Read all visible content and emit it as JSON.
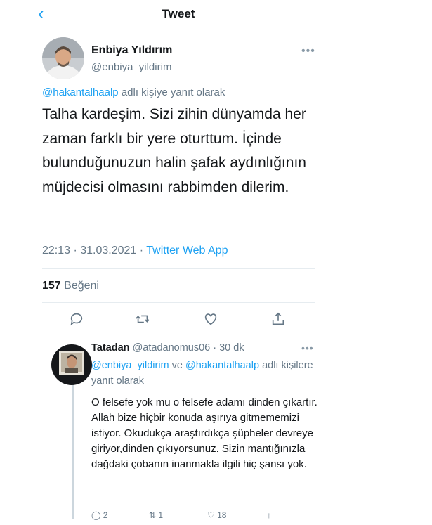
{
  "header": {
    "title": "Tweet"
  },
  "tweet": {
    "author_name": "Enbiya Yıldırım",
    "author_handle": "@enbiya_yildirim",
    "reply_to_handle": "@hakantalhaalp",
    "reply_to_suffix": "adlı kişiye yanıt olarak",
    "text": "Talha kardeşim. Sizi zihin dünyamda her zaman farklı bir yere oturttum. İçinde bulunduğunuzun halin şafak aydınlığının müjdecisi olmasını rabbimden dilerim.",
    "timestamp": "22:13 · 31.03.2021 · ",
    "source": "Twitter Web App",
    "likes_count": "157",
    "likes_label": "Beğeni"
  },
  "actions": [
    "reply-icon",
    "retweet-icon",
    "like-icon",
    "share-icon"
  ],
  "reply": {
    "author_name": "Tatadan",
    "author_handle": "@atadanomus06",
    "time": " · 30 dk",
    "mention1": "@enbiya_yildirim",
    "mention_joiner": "ve",
    "mention2": "@hakantalhaalp",
    "reply_suffix": "adlı kişilere yanıt olarak",
    "text": "O felsefe yok mu o felsefe adamı dinden çıkartır. Allah bize hiçbir konuda aşırıya gitmememizi istiyor. Okudukça araştırdıkça şüpheler devreye giriyor,dinden çıkıyorsunuz. Sizin mantığınızla dağdaki çobanın inanmakla ilgili hiç şansı yok.",
    "reply_count": "2",
    "retweet_count": "1",
    "like_count": "18"
  },
  "colors": {
    "accent": "#1da1f2",
    "secondary": "#657786",
    "divider": "#e6ecf0"
  }
}
